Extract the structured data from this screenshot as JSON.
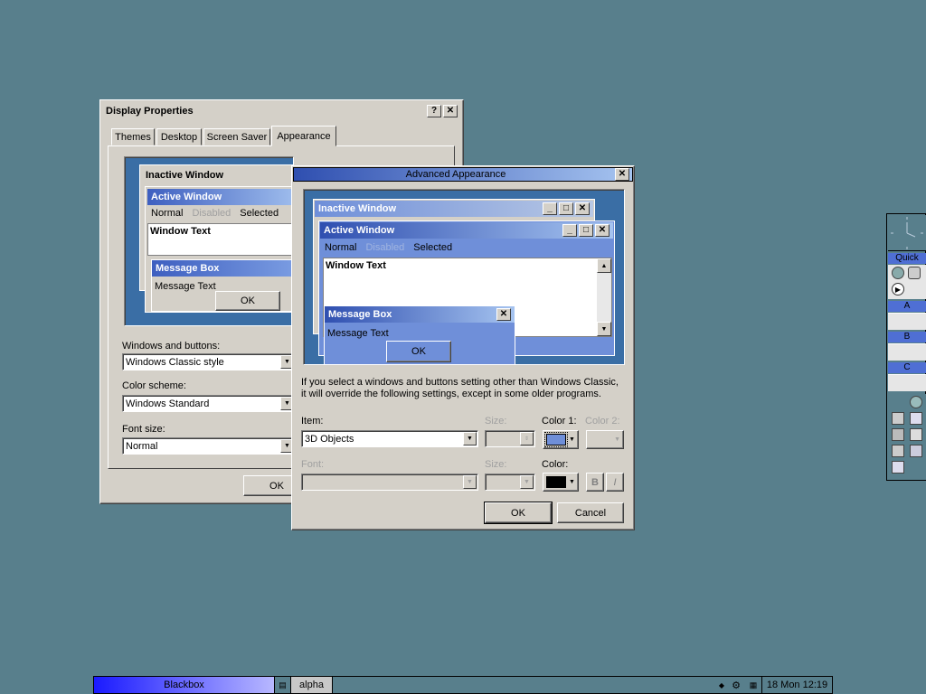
{
  "display_properties": {
    "title": "Display Properties",
    "tabs": [
      "Themes",
      "Desktop",
      "Screen Saver",
      "Appearance"
    ],
    "preview": {
      "inactive": "Inactive Window",
      "active": "Active Window",
      "normal": "Normal",
      "disabled": "Disabled",
      "selected": "Selected",
      "window_text": "Window Text",
      "message_box": "Message Box",
      "message_text": "Message Text",
      "ok": "OK"
    },
    "windows_buttons_label": "Windows and buttons:",
    "windows_buttons_value": "Windows Classic style",
    "color_scheme_label": "Color scheme:",
    "color_scheme_value": "Windows Standard",
    "font_size_label": "Font size:",
    "font_size_value": "Normal",
    "ok": "OK"
  },
  "advanced": {
    "title": "Advanced Appearance",
    "preview": {
      "inactive": "Inactive Window",
      "active": "Active Window",
      "normal": "Normal",
      "disabled": "Disabled",
      "selected": "Selected",
      "window_text": "Window Text",
      "message_box": "Message Box",
      "message_text": "Message Text",
      "ok": "OK"
    },
    "info_line1": "If you select a windows and buttons setting other than Windows Classic,",
    "info_line2": "it will override the following settings, except in some older programs.",
    "item_label": "Item:",
    "item_value": "3D Objects",
    "size_label": "Size:",
    "color1_label": "Color 1:",
    "color2_label": "Color 2:",
    "font_label": "Font:",
    "font_size_label": "Size:",
    "color_label": "Color:",
    "bold": "B",
    "italic": "I",
    "ok": "OK",
    "cancel": "Cancel",
    "color1_swatch": "#6f8fd9",
    "font_color_swatch": "#000000"
  },
  "taskbar": {
    "workspace": "Blackbox",
    "task": "alpha",
    "clock": "18 Mon 12:19"
  },
  "dock": {
    "quick": "Quick",
    "a": "A",
    "b": "B",
    "c": "C"
  },
  "colors": {
    "desktop": "#587f8c",
    "active_title_start": "#2f4fb0",
    "active_title_end": "#a6c4f0",
    "preview_bg": "#3a6ea5"
  }
}
